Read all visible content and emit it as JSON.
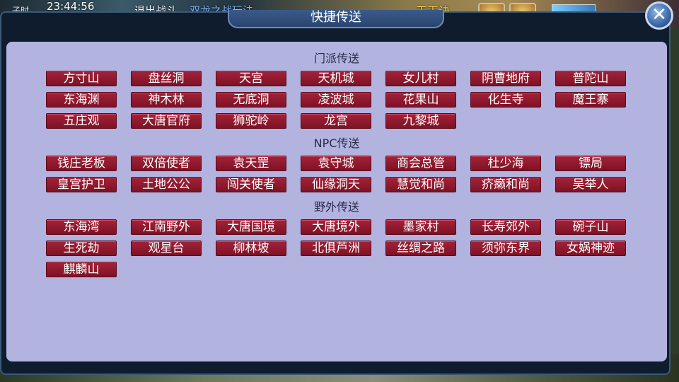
{
  "hud": {
    "left_label": "子时",
    "clock": "23:44:56",
    "exit_battle": "退出战斗",
    "war_event": "双龙之战玩法",
    "right_label": "天王诀"
  },
  "panel": {
    "title": "快捷传送",
    "close_icon": "close-icon"
  },
  "sections": [
    {
      "title": "门派传送",
      "buttons": [
        "方寸山",
        "盘丝洞",
        "天宫",
        "天机城",
        "女儿村",
        "阴曹地府",
        "普陀山",
        "东海渊",
        "神木林",
        "无底洞",
        "凌波城",
        "花果山",
        "化生寺",
        "魔王寨",
        "五庄观",
        "大唐官府",
        "狮驼岭",
        "龙宫",
        "九黎城"
      ]
    },
    {
      "title": "NPC传送",
      "buttons": [
        "钱庄老板",
        "双倍使者",
        "袁天罡",
        "袁守城",
        "商会总管",
        "杜少海",
        "镖局",
        "皇宫护卫",
        "土地公公",
        "闯关使者",
        "仙缘洞天",
        "慧觉和尚",
        "疥癞和尚",
        "吴举人"
      ]
    },
    {
      "title": "野外传送",
      "buttons": [
        "东海湾",
        "江南野外",
        "大唐国境",
        "大唐境外",
        "墨家村",
        "长寿郊外",
        "碗子山",
        "生死劫",
        "观星台",
        "柳林坡",
        "北俱芦洲",
        "丝绸之路",
        "须弥东界",
        "女娲神迹",
        "麒麟山"
      ]
    }
  ]
}
